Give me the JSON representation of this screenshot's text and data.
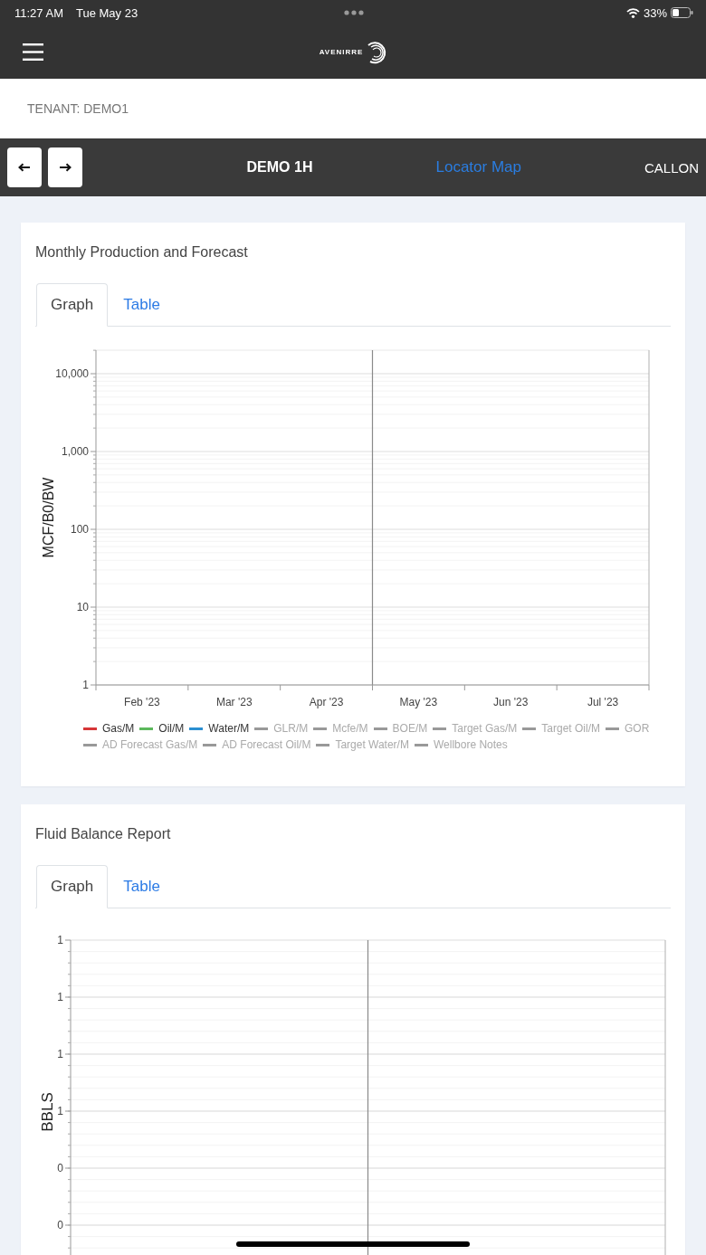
{
  "status_bar": {
    "time": "11:27 AM",
    "date": "Tue May 23",
    "battery": "33%"
  },
  "header": {
    "logo_text": "AVENIRRE"
  },
  "tenant": {
    "label": "TENANT: DEMO1"
  },
  "nav": {
    "well": "DEMO 1H",
    "link": "Locator Map",
    "operator": "CALLON"
  },
  "cards": [
    {
      "title": "Monthly Production and Forecast",
      "tabs": [
        {
          "label": "Graph",
          "selected": true
        },
        {
          "label": "Table",
          "selected": false
        }
      ],
      "chart": {
        "kind": "log",
        "ylabel": "MCF/B0/BW",
        "ytick_labels": [
          "10,000",
          "1,000",
          "100",
          "10",
          "1"
        ],
        "xtick_labels": [
          "Feb '23",
          "Mar '23",
          "Apr '23",
          "May '23",
          "Jun '23",
          "Jul '23"
        ],
        "legend": [
          {
            "label": "Gas/M",
            "color": "#d63638",
            "hidden": false
          },
          {
            "label": "Oil/M",
            "color": "#5cb85c",
            "hidden": false
          },
          {
            "label": "Water/M",
            "color": "#2b8fd1",
            "hidden": false
          },
          {
            "label": "GLR/M",
            "color": "#999999",
            "hidden": true
          },
          {
            "label": "Mcfe/M",
            "color": "#999999",
            "hidden": true
          },
          {
            "label": "BOE/M",
            "color": "#999999",
            "hidden": true
          },
          {
            "label": "Target Gas/M",
            "color": "#999999",
            "hidden": true
          },
          {
            "label": "Target Oil/M",
            "color": "#999999",
            "hidden": true
          },
          {
            "label": "GOR",
            "color": "#999999",
            "hidden": true
          },
          {
            "label": "AD Forecast Gas/M",
            "color": "#999999",
            "hidden": true
          },
          {
            "label": "AD Forecast Oil/M",
            "color": "#999999",
            "hidden": true
          },
          {
            "label": "Target Water/M",
            "color": "#999999",
            "hidden": true
          },
          {
            "label": "Wellbore Notes",
            "color": "#999999",
            "hidden": true
          }
        ]
      }
    },
    {
      "title": "Fluid Balance Report",
      "tabs": [
        {
          "label": "Graph",
          "selected": true
        },
        {
          "label": "Table",
          "selected": false
        }
      ],
      "chart": {
        "kind": "linear",
        "ylabel": "BBLS",
        "ytick_labels": [
          "1",
          "1",
          "1",
          "1",
          "0",
          "0"
        ]
      }
    }
  ]
}
